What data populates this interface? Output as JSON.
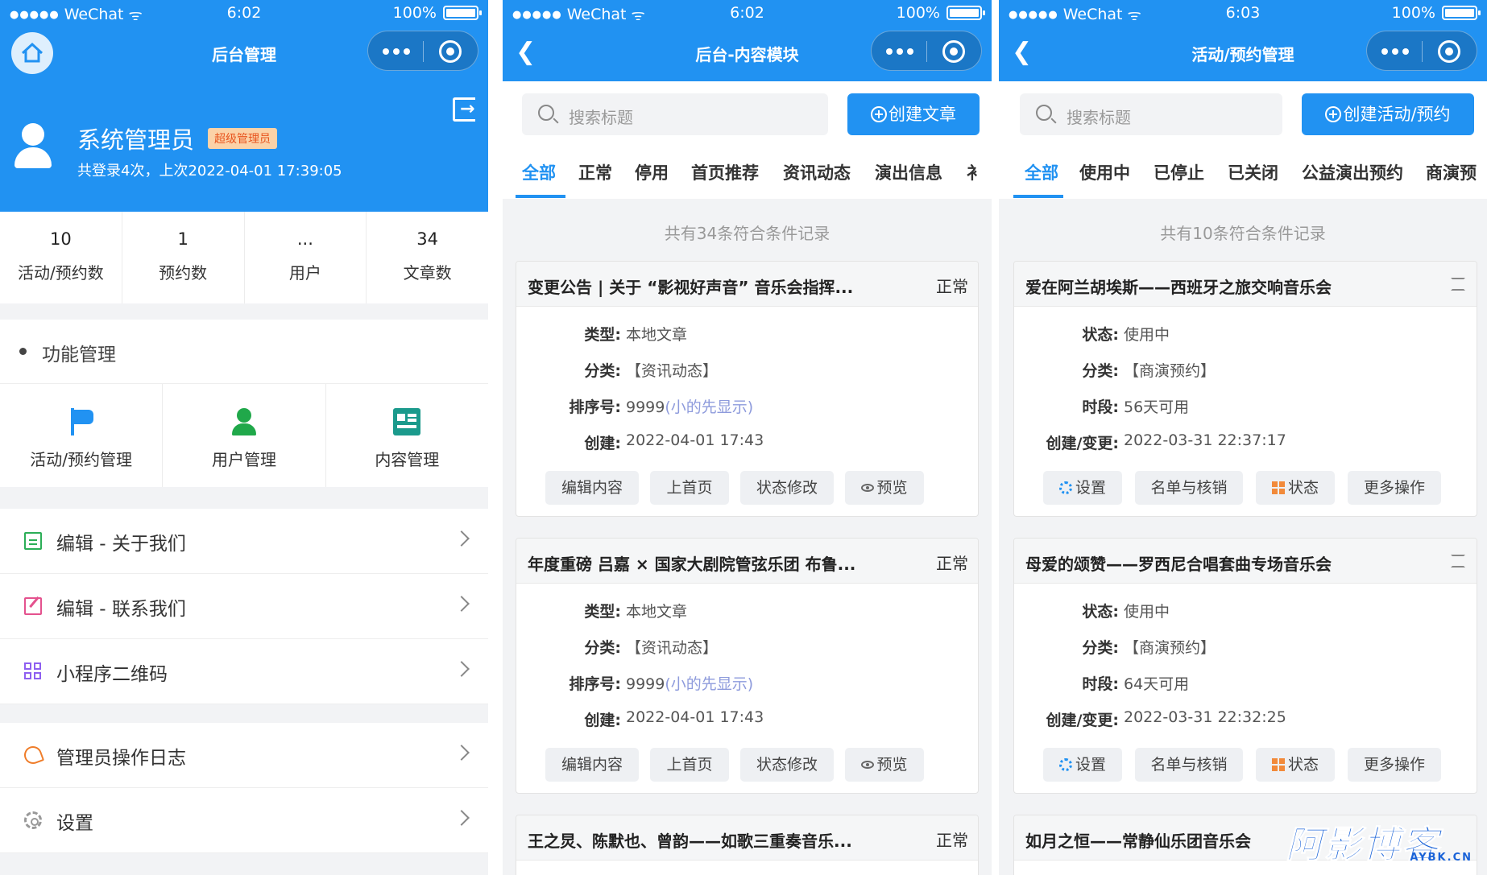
{
  "status": {
    "carrier": "WeChat",
    "battery": "100%",
    "battery_level": 1.0
  },
  "phone1": {
    "time": "6:02",
    "nav_title": "后台管理",
    "profile": {
      "name": "系统管理员",
      "badge": "超级管理员",
      "info": "共登录4次，上次2022-04-01 17:39:05"
    },
    "stats": [
      {
        "num": "10",
        "label": "活动/预约数"
      },
      {
        "num": "1",
        "label": "预约数"
      },
      {
        "num": "...",
        "label": "用户"
      },
      {
        "num": "34",
        "label": "文章数"
      }
    ],
    "section_title": "功能管理",
    "functions": [
      {
        "label": "活动/预约管理",
        "icon": "flag-icon",
        "color": "#2192f2"
      },
      {
        "label": "用户管理",
        "icon": "user-icon",
        "color": "#20a84a"
      },
      {
        "label": "内容管理",
        "icon": "news-icon",
        "color": "#1b9a8c"
      }
    ],
    "menu1": [
      {
        "label": "编辑 - 关于我们",
        "icon": "edit-icon"
      },
      {
        "label": "编辑 - 联系我们",
        "icon": "edit-icon"
      },
      {
        "label": "小程序二维码",
        "icon": "qrcode-icon"
      }
    ],
    "menu2": [
      {
        "label": "管理员操作日志",
        "icon": "log-icon"
      },
      {
        "label": "设置",
        "icon": "gear-icon"
      }
    ]
  },
  "phone2": {
    "time": "6:02",
    "nav_title": "后台-内容模块",
    "search_placeholder": "搜索标题",
    "create_label": "创建文章",
    "tabs": [
      "全部",
      "正常",
      "停用",
      "首页推荐",
      "资讯动态",
      "演出信息",
      "衤"
    ],
    "active_tab": 0,
    "count_text": "共有34条符合条件记录",
    "cards": [
      {
        "title": "变更公告 | 关于 “影视好声音” 音乐会指挥...",
        "status": "正常",
        "rows": [
          {
            "key": "类型:",
            "value": "本地文章"
          },
          {
            "key": "分类:",
            "value": "【资讯动态】"
          },
          {
            "key": "排序号:",
            "value": "9999",
            "hint": "(小的先显示)"
          },
          {
            "key": "创建:",
            "value": "2022-04-01 17:43"
          }
        ],
        "buttons": [
          "编辑内容",
          "上首页",
          "状态修改",
          "预览"
        ]
      },
      {
        "title": "年度重磅 吕嘉 × 国家大剧院管弦乐团 布鲁...",
        "status": "正常",
        "rows": [
          {
            "key": "类型:",
            "value": "本地文章"
          },
          {
            "key": "分类:",
            "value": "【资讯动态】"
          },
          {
            "key": "排序号:",
            "value": "9999",
            "hint": "(小的先显示)"
          },
          {
            "key": "创建:",
            "value": "2022-04-01 17:43"
          }
        ],
        "buttons": [
          "编辑内容",
          "上首页",
          "状态修改",
          "预览"
        ]
      },
      {
        "title": "王之炅、陈默也、曾韵——如歌三重奏音乐...",
        "status": "正常"
      }
    ]
  },
  "phone3": {
    "time": "6:03",
    "nav_title": "活动/预约管理",
    "search_placeholder": "搜索标题",
    "create_label": "创建活动/预约",
    "tabs": [
      "全部",
      "使用中",
      "已停止",
      "已关闭",
      "公益演出预约",
      "商演预"
    ],
    "active_tab": 0,
    "count_text": "共有10条符合条件记录",
    "cards": [
      {
        "title": "爱在阿兰胡埃斯——西班牙之旅交响音乐会",
        "rows": [
          {
            "key": "状态:",
            "value": "使用中"
          },
          {
            "key": "分类:",
            "value": "【商演预约】"
          },
          {
            "key": "时段:",
            "value": "56天可用"
          },
          {
            "key": "创建/变更:",
            "value": "2022-03-31 22:37:17"
          }
        ],
        "buttons": [
          "设置",
          "名单与核销",
          "状态",
          "更多操作"
        ]
      },
      {
        "title": "母爱的颂赞——罗西尼合唱套曲专场音乐会",
        "rows": [
          {
            "key": "状态:",
            "value": "使用中"
          },
          {
            "key": "分类:",
            "value": "【商演预约】"
          },
          {
            "key": "时段:",
            "value": "64天可用"
          },
          {
            "key": "创建/变更:",
            "value": "2022-03-31 22:32:25"
          }
        ],
        "buttons": [
          "设置",
          "名单与核销",
          "状态",
          "更多操作"
        ]
      },
      {
        "title": "如月之恒——常静仙乐团音乐会"
      }
    ]
  },
  "watermark": {
    "text_cn": "阿影博客",
    "text_en": "AYBK.CN"
  }
}
